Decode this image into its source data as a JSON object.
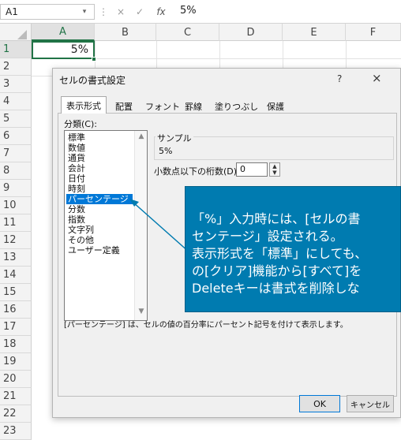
{
  "formula_bar": {
    "name_box": "A1",
    "dropdown_glyph": "▾",
    "separator_glyph": "⋮",
    "cancel_glyph": "×",
    "enter_glyph": "✓",
    "fx_label": "fx",
    "formula_value": "5%"
  },
  "columns": [
    "A",
    "B",
    "C",
    "D",
    "E",
    "F"
  ],
  "rows": [
    "1",
    "2",
    "3",
    "4",
    "5",
    "6",
    "7",
    "8",
    "9",
    "10",
    "11",
    "12",
    "13",
    "14",
    "15",
    "16",
    "17",
    "18",
    "19",
    "20",
    "21",
    "22",
    "23"
  ],
  "cell_a1_value": "5%",
  "dialog": {
    "title": "セルの書式設定",
    "help": "?",
    "close": "×",
    "tabs": [
      "表示形式",
      "配置",
      "フォント",
      "罫線",
      "塗りつぶし",
      "保護"
    ],
    "active_tab": "表示形式",
    "category_label": "分類(C):",
    "categories": [
      "標準",
      "数値",
      "通貨",
      "会計",
      "日付",
      "時刻",
      "パーセンテージ",
      "分数",
      "指数",
      "文字列",
      "その他",
      "ユーザー定義"
    ],
    "selected_category": "パーセンテージ",
    "scroll_up": "▲",
    "scroll_down": "▼",
    "sample_label": "サンプル",
    "sample_value": "5%",
    "decimal_label": "小数点以下の桁数(D):",
    "decimal_value": "0",
    "spin_up": "▲",
    "spin_down": "▼",
    "description": "[パーセンテージ] は、セルの値の百分率にパーセント記号を付けて表示します。",
    "ok_label": "OK",
    "cancel_label": "キャンセル"
  },
  "callout": {
    "lines": [
      "「%」入力時には、[セルの書",
      "センテージ」設定される。",
      "表示形式を「標準」にしても、",
      "の[クリア]機能から[すべて]を",
      "Deleteキーは書式を削除しな"
    ],
    "color": "#007bb0"
  },
  "colors": {
    "selection_border": "#217346",
    "list_selection": "#0078d7"
  }
}
